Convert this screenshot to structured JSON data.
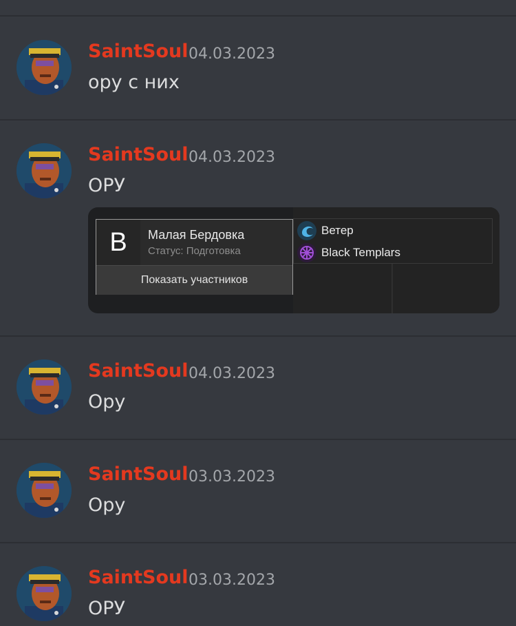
{
  "messages": [
    {
      "author": "SaintSoul",
      "date": "04.03.2023",
      "text": "ору с них"
    },
    {
      "author": "SaintSoul",
      "date": "04.03.2023",
      "text": "ОРУ",
      "embed": {
        "letter": "B",
        "title": "Малая Бердовка",
        "status": "Статус: Подготовка",
        "button": "Показать участников",
        "factions": [
          {
            "name": "Ветер",
            "icon": "wind-faction-icon",
            "color": "#4fb3e6"
          },
          {
            "name": "Black Templars",
            "icon": "black-templars-faction-icon",
            "color": "#a04fd6"
          }
        ]
      }
    },
    {
      "author": "SaintSoul",
      "date": "04.03.2023",
      "text": "Ору"
    },
    {
      "author": "SaintSoul",
      "date": "03.03.2023",
      "text": "Ору"
    },
    {
      "author": "SaintSoul",
      "date": "03.03.2023",
      "text": "ОРУ"
    }
  ],
  "colors": {
    "background": "#36393f",
    "author": "#e4391f",
    "timestamp": "#a3a6aa",
    "text": "#dcddde"
  }
}
